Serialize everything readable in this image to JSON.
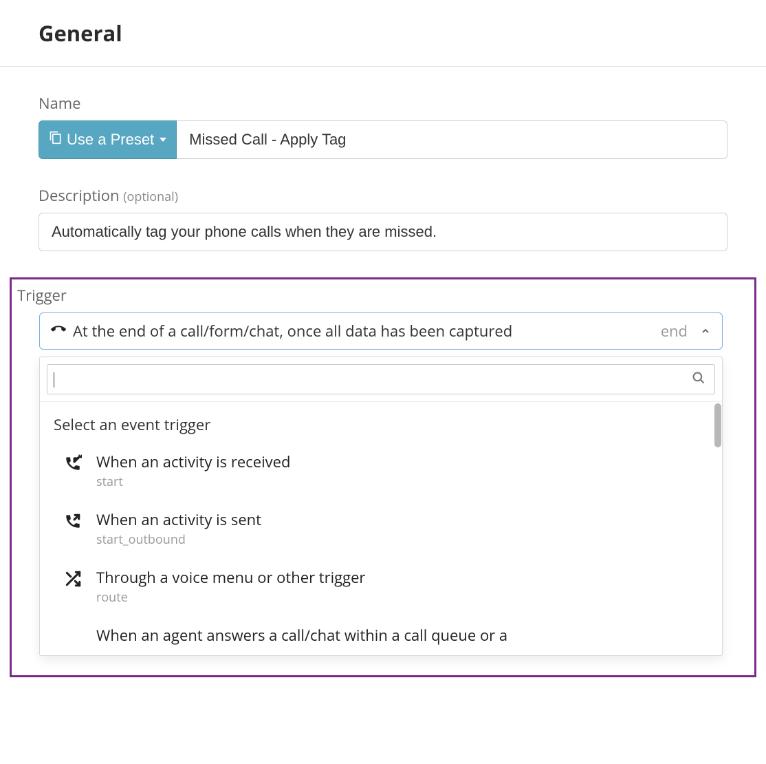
{
  "section": {
    "title": "General"
  },
  "name_field": {
    "label": "Name",
    "preset_button": "Use a Preset",
    "value": "Missed Call - Apply Tag"
  },
  "description_field": {
    "label": "Description",
    "optional": "(optional)",
    "value": "Automatically tag your phone calls when they are missed."
  },
  "trigger": {
    "label": "Trigger",
    "selected_text": "At the end of a call/form/chat, once all data has been captured",
    "selected_tag": "end",
    "search_value": "",
    "group_header": "Select an event trigger",
    "options": [
      {
        "title": "When an activity is received",
        "sub": "start",
        "icon": "phone-incoming"
      },
      {
        "title": "When an activity is sent",
        "sub": "start_outbound",
        "icon": "phone-outgoing"
      },
      {
        "title": "Through a voice menu or other trigger",
        "sub": "route",
        "icon": "shuffle"
      },
      {
        "title": "When an agent answers a call/chat within a call queue or a",
        "sub": "",
        "icon": ""
      }
    ]
  }
}
